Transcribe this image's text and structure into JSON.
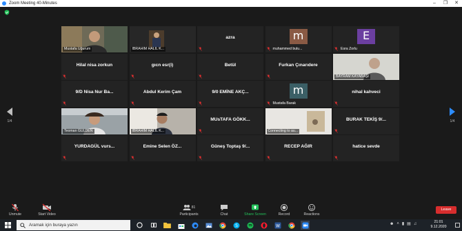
{
  "window": {
    "title": "Zoom Meeting 40-Minutes"
  },
  "gallery": {
    "page_left": "1/4",
    "page_right": "1/4"
  },
  "tiles": [
    {
      "text": "Mustafa Uğurum",
      "kind": "video",
      "active": true
    },
    {
      "text": "İBRAHİM HALİL K...",
      "kind": "video"
    },
    {
      "text": "azra",
      "kind": "name"
    },
    {
      "text": "muhammed bulu...",
      "kind": "avatar",
      "avatar_letter": "m",
      "avatar_color": "#8a5a44"
    },
    {
      "text": "Esra Zorlu",
      "kind": "avatar",
      "avatar_letter": "E",
      "avatar_color": "#6b3fa0"
    },
    {
      "text": "Hilal nisa zorkun",
      "kind": "name"
    },
    {
      "text": "gıcn esr(i)",
      "kind": "name"
    },
    {
      "text": "Betül",
      "kind": "name"
    },
    {
      "text": "Furkan Çınarıdere",
      "kind": "name"
    },
    {
      "text": "BAYRAM KAYABAŞI",
      "kind": "video"
    },
    {
      "text": "9/D Nisa Nur Ba...",
      "kind": "name"
    },
    {
      "text": "Abdul Kerim Çam",
      "kind": "name"
    },
    {
      "text": "9/0 EMİNE AKÇ...",
      "kind": "name"
    },
    {
      "text": "Mustafa Barak",
      "kind": "avatar",
      "avatar_letter": "m",
      "avatar_color": "#3b5f66"
    },
    {
      "text": "nihal kahveci",
      "kind": "name"
    },
    {
      "text": "Teoman GÜLDEN",
      "kind": "video"
    },
    {
      "text": "İBRAHİM HALİL K...",
      "kind": "video"
    },
    {
      "text": "MUsTAFA GÖKK...",
      "kind": "name"
    },
    {
      "text": "Connecting to au...",
      "kind": "video"
    },
    {
      "text": "BURAK TEKİŞ 9/...",
      "kind": "name"
    },
    {
      "text": "YURDAGÜL vurs...",
      "kind": "name"
    },
    {
      "text": "Emine Selen ÖZ...",
      "kind": "name"
    },
    {
      "text": "Güneş Toptaş 9/...",
      "kind": "name"
    },
    {
      "text": "RECEP AĞIR",
      "kind": "name"
    },
    {
      "text": "hatice sevde",
      "kind": "name"
    }
  ],
  "controls": {
    "unmute": "Unmute",
    "start_video": "Start Video",
    "participants": "Participants",
    "participants_count": "81",
    "chat": "Chat",
    "share_screen": "Share Screen",
    "record": "Record",
    "reactions": "Reactions",
    "leave": "Leave"
  },
  "taskbar": {
    "search_placeholder": "Aramak için buraya yazın",
    "time": "21:01",
    "date": "9.12.2020"
  },
  "colors": {
    "active_speaker": "#9bd22c",
    "zoom_blue": "#2d8cff",
    "leave_red": "#d72d2d",
    "share_green": "#23c25a"
  }
}
